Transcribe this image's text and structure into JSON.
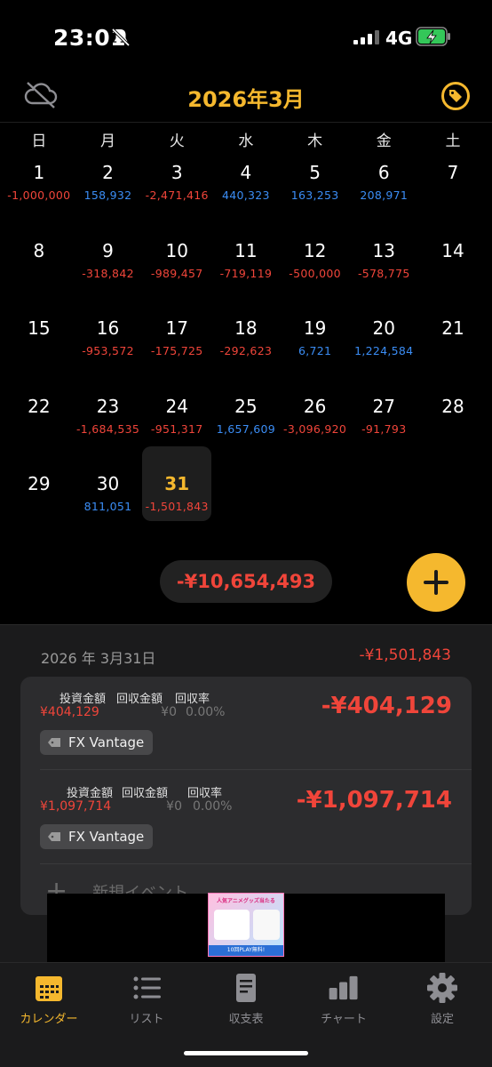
{
  "status": {
    "time": "23:01",
    "network": "4G"
  },
  "header": {
    "title": "2026年3月"
  },
  "weekdays": [
    "日",
    "月",
    "火",
    "水",
    "木",
    "金",
    "土"
  ],
  "weeks": [
    [
      {
        "d": "1",
        "v": "-1,000,000"
      },
      {
        "d": "2",
        "v": "158,932"
      },
      {
        "d": "3",
        "v": "-2,471,416"
      },
      {
        "d": "4",
        "v": "440,323"
      },
      {
        "d": "5",
        "v": "163,253"
      },
      {
        "d": "6",
        "v": "208,971"
      },
      {
        "d": "7",
        "v": ""
      }
    ],
    [
      {
        "d": "8",
        "v": ""
      },
      {
        "d": "9",
        "v": "-318,842"
      },
      {
        "d": "10",
        "v": "-989,457"
      },
      {
        "d": "11",
        "v": "-719,119"
      },
      {
        "d": "12",
        "v": "-500,000"
      },
      {
        "d": "13",
        "v": "-578,775"
      },
      {
        "d": "14",
        "v": ""
      }
    ],
    [
      {
        "d": "15",
        "v": ""
      },
      {
        "d": "16",
        "v": "-953,572"
      },
      {
        "d": "17",
        "v": "-175,725"
      },
      {
        "d": "18",
        "v": "-292,623"
      },
      {
        "d": "19",
        "v": "6,721"
      },
      {
        "d": "20",
        "v": "1,224,584"
      },
      {
        "d": "21",
        "v": ""
      }
    ],
    [
      {
        "d": "22",
        "v": ""
      },
      {
        "d": "23",
        "v": "-1,684,535"
      },
      {
        "d": "24",
        "v": "-951,317"
      },
      {
        "d": "25",
        "v": "1,657,609"
      },
      {
        "d": "26",
        "v": "-3,096,920"
      },
      {
        "d": "27",
        "v": "-91,793"
      },
      {
        "d": "28",
        "v": ""
      }
    ],
    [
      {
        "d": "29",
        "v": ""
      },
      {
        "d": "30",
        "v": "811,051"
      },
      {
        "d": "31",
        "v": "-1,501,843",
        "today": true
      },
      {
        "d": "",
        "v": ""
      },
      {
        "d": "",
        "v": ""
      },
      {
        "d": "",
        "v": ""
      },
      {
        "d": "",
        "v": ""
      }
    ]
  ],
  "month_total": "-¥10,654,493",
  "detail": {
    "date": "2026 年 3月31日",
    "day_total": "-¥1,501,843",
    "labels": {
      "invest": "投資金額",
      "recovered": "回収金額",
      "rate": "回収率"
    },
    "entries": [
      {
        "invest": "¥404,129",
        "recovered": "¥0",
        "rate": "0.00%",
        "amount": "-¥404,129",
        "tag": "FX Vantage"
      },
      {
        "invest": "¥1,097,714",
        "recovered": "¥0",
        "rate": "0.00%",
        "amount": "-¥1,097,714",
        "tag": "FX Vantage"
      }
    ],
    "new_event": "新規イベント"
  },
  "ad": {
    "top_text": "人気アニメグッズ当たる",
    "bottom_text": "10回PLAY無料!"
  },
  "tabs": [
    {
      "label": "カレンダー",
      "icon": "calendar-icon",
      "active": true
    },
    {
      "label": "リスト",
      "icon": "list-icon"
    },
    {
      "label": "収支表",
      "icon": "document-icon"
    },
    {
      "label": "チャート",
      "icon": "bar-chart-icon"
    },
    {
      "label": "設定",
      "icon": "gear-icon"
    }
  ],
  "colors": {
    "accent": "#f5b82e",
    "negative": "#f0453a",
    "positive": "#3b8df5"
  }
}
